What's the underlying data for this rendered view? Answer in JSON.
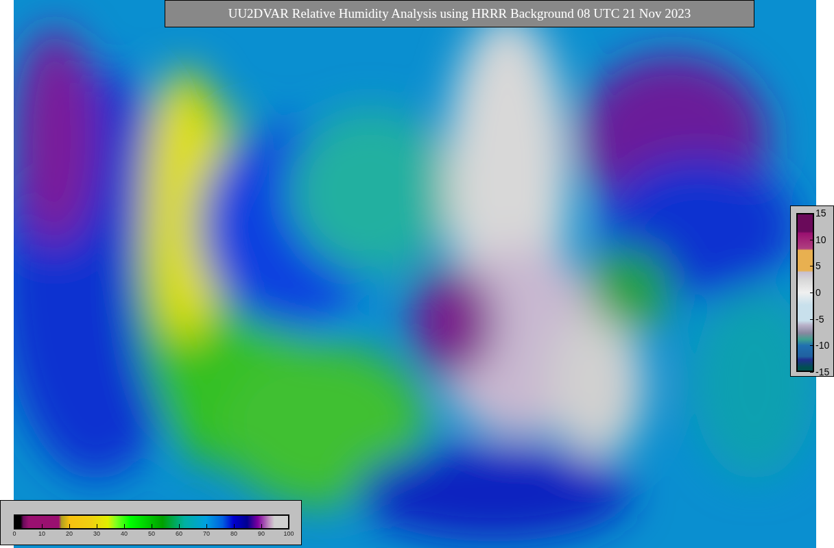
{
  "title": "UU2DVAR Relative Humidity Analysis using HRRR Background 08 UTC 21 Nov 2023",
  "humidity_colorbar": {
    "labels": [
      "0",
      "10",
      "20",
      "30",
      "40",
      "50",
      "60",
      "70",
      "80",
      "90",
      "100"
    ]
  },
  "difference_colorbar": {
    "labels": [
      "15",
      "10",
      "5",
      "0",
      "-5",
      "-10",
      "-15"
    ]
  }
}
